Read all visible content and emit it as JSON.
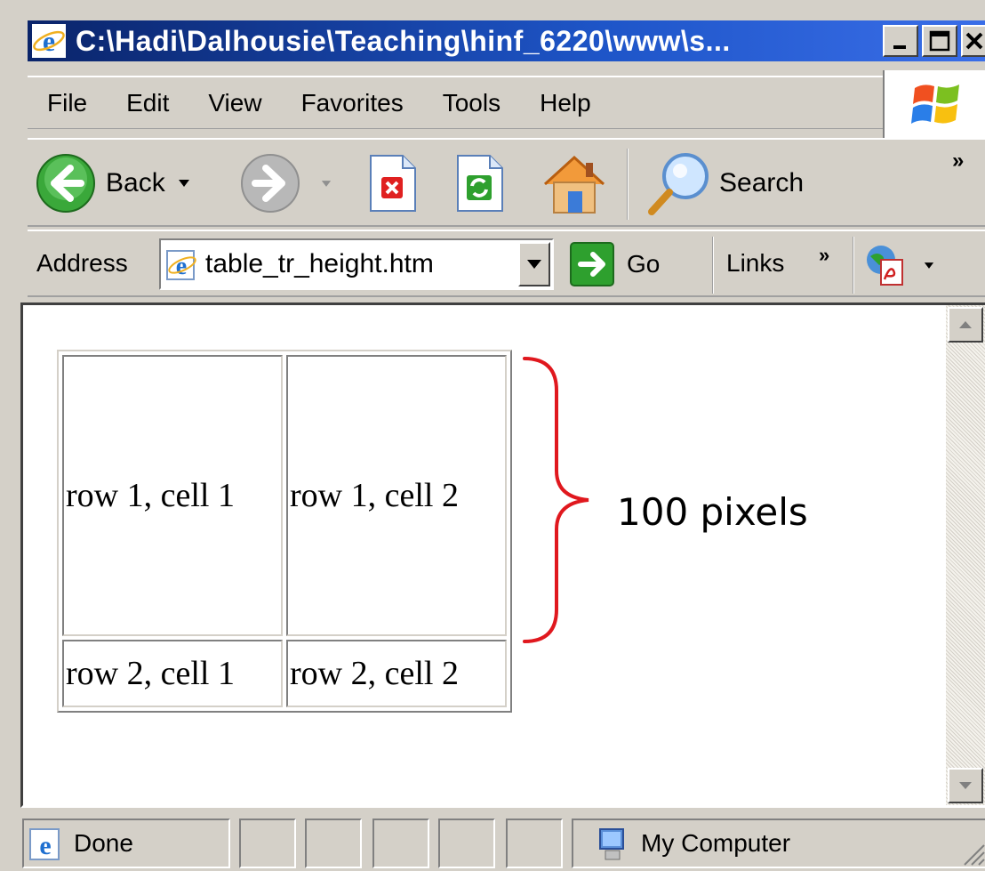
{
  "window": {
    "title": "C:\\Hadi\\Dalhousie\\Teaching\\hinf_6220\\www\\s...",
    "icon": "ie-logo-icon",
    "controls": [
      "minimize",
      "maximize",
      "close"
    ]
  },
  "menu": {
    "items": [
      "File",
      "Edit",
      "View",
      "Favorites",
      "Tools",
      "Help"
    ]
  },
  "toolbar": {
    "back_label": "Back",
    "search_label": "Search",
    "overflow": "»"
  },
  "address": {
    "label": "Address",
    "value": "table_tr_height.htm",
    "go_label": "Go",
    "links_label": "Links",
    "links_overflow": "»"
  },
  "content": {
    "table": {
      "rows": [
        [
          "row 1, cell 1",
          "row 1, cell 2"
        ],
        [
          "row 2, cell 1",
          "row 2, cell 2"
        ]
      ]
    },
    "annotation": "100 pixels",
    "annotation_color": "#e0181e"
  },
  "status": {
    "text": "Done",
    "zone": "My Computer"
  },
  "colors": {
    "title_start": "#0a246a",
    "title_end": "#3a6ee8",
    "chrome": "#d4d0c8"
  }
}
